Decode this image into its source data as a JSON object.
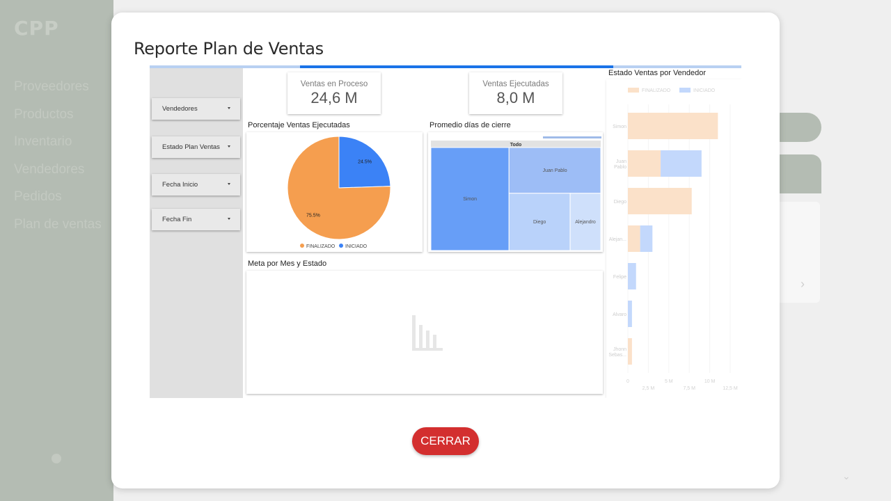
{
  "background": {
    "logo": "CPP",
    "nav": [
      "Proveedores",
      "Productos",
      "Inventario",
      "Vendedores",
      "Pedidos",
      "Plan de ventas"
    ]
  },
  "modal": {
    "title": "Reporte Plan de Ventas",
    "close_label": "CERRAR"
  },
  "report": {
    "progress": 0.71,
    "filters": [
      {
        "label": "Vendedores"
      },
      {
        "label": "Estado Plan Ventas"
      },
      {
        "label": "Fecha Inicio"
      },
      {
        "label": "Fecha Fin"
      }
    ],
    "kpis": [
      {
        "label": "Ventas en Proceso",
        "value": "24,6 M"
      },
      {
        "label": "Ventas Ejecutadas",
        "value": "8,0 M"
      }
    ],
    "pie_title": "Porcentaje Ventas Ejecutadas",
    "treemap_title": "Promedio días de cierre",
    "meta_title": "Meta por Mes y Estado",
    "bar_title": "Estado Ventas por Vendedor"
  },
  "colors": {
    "finalizado": "#f59e4f",
    "iniciado": "#3b82f6",
    "close_button": "#d32f2f",
    "progress": "#1a73e8"
  },
  "chart_data": [
    {
      "type": "pie",
      "title": "Porcentaje Ventas Ejecutadas",
      "categories": [
        "FINALIZADO",
        "INICIADO"
      ],
      "values": [
        75.5,
        24.5
      ],
      "labels": [
        "75.5%",
        "24.5%"
      ],
      "legend": "bottom"
    },
    {
      "type": "treemap",
      "title": "Promedio días de cierre",
      "root": "Todo",
      "categories": [
        "Simon",
        "Juan Pablo",
        "Diego",
        "Alejandro"
      ],
      "values": [
        46,
        24,
        20,
        10
      ]
    },
    {
      "type": "bar",
      "orientation": "horizontal",
      "stacked": true,
      "title": "Estado Ventas por Vendedor",
      "categories": [
        "Simon",
        "Juan Pablo",
        "Diego",
        "Alejandro",
        "Felipe",
        "Alvaro",
        "Jhonn Sebastian"
      ],
      "category_labels": [
        "Simon",
        "Juan Pablo",
        "Diego",
        "Alejan...",
        "Felipe",
        "Alvaro",
        "Jhonn Sebas..."
      ],
      "series": [
        {
          "name": "FINALIZADO",
          "values": [
            11,
            4,
            7.8,
            1.5,
            0,
            0,
            0.5
          ]
        },
        {
          "name": "INICIADO",
          "values": [
            0,
            5,
            0,
            1.5,
            1,
            0.5,
            0
          ]
        }
      ],
      "xlim": [
        0,
        12.5
      ],
      "xticks": [
        "0",
        "2,5 M",
        "5 M",
        "7,5 M",
        "10 M",
        "12,5 M"
      ],
      "legend": "top-left",
      "grid": true
    }
  ]
}
